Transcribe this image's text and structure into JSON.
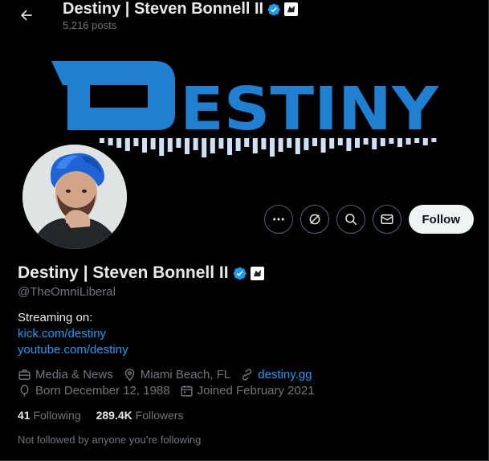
{
  "header": {
    "name": "Destiny | Steven Bonnell II",
    "post_count": "5,216 posts"
  },
  "banner": {
    "logo_text": "DESTINY",
    "colors": {
      "logo": "#1f7fd1",
      "background": "#000000"
    }
  },
  "actions": {
    "more_icon": "more-icon",
    "grok_icon": "grok-icon",
    "search_icon": "search-icon",
    "message_icon": "message-icon",
    "follow_label": "Follow"
  },
  "profile": {
    "display_name": "Destiny | Steven Bonnell II",
    "handle": "@TheOmniLiberal",
    "bio_line": "Streaming on:",
    "bio_links": [
      "kick.com/destiny",
      "youtube.com/destiny"
    ],
    "category": "Media & News",
    "location": "Miami Beach, FL",
    "website": "destiny.gg",
    "birthday": "Born December 12, 1988",
    "joined": "Joined February 2021",
    "following_count": "41",
    "following_label": "Following",
    "followers_count": "289.4K",
    "followers_label": "Followers",
    "not_followed_text": "Not followed by anyone you’re following"
  },
  "colors": {
    "accent": "#1d9bf0",
    "muted": "#71767b",
    "text": "#e7e9ea",
    "verified": "#1d9bf0"
  }
}
